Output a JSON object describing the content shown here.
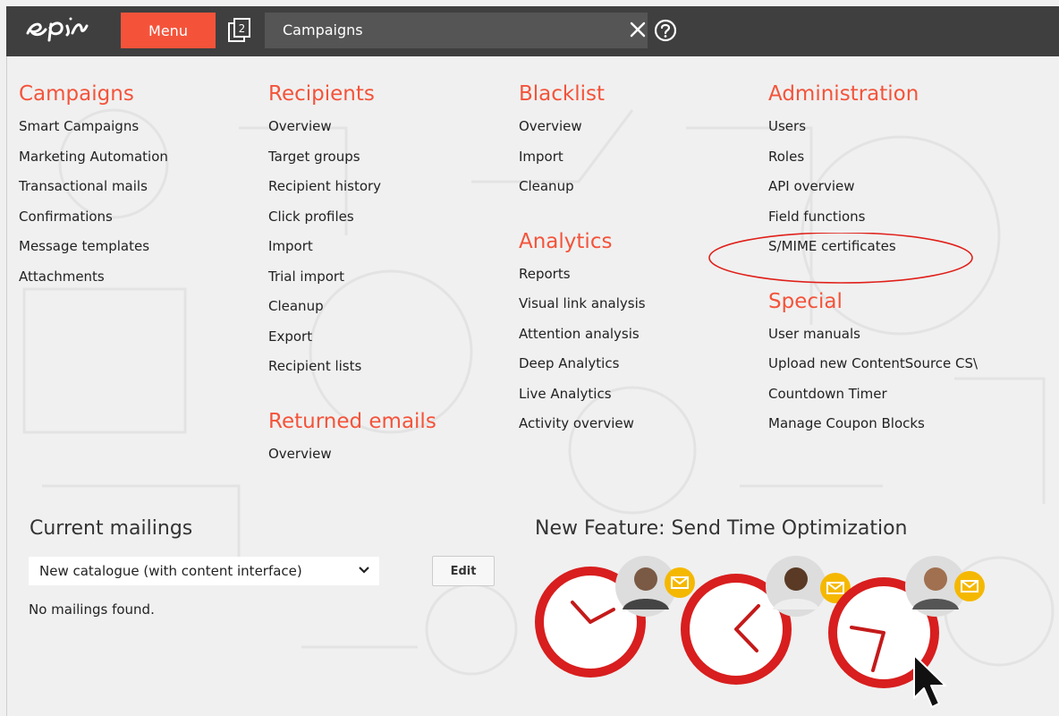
{
  "topbar": {
    "logo_text": "epi",
    "menu_label": "Menu",
    "open_windows_count": "2",
    "search_value": "Campaigns"
  },
  "columns": [
    {
      "sections": [
        {
          "title": "Campaigns",
          "items": [
            "Smart Campaigns",
            "Marketing Automation",
            "Transactional mails",
            "Confirmations",
            "Message templates",
            "Attachments"
          ]
        }
      ]
    },
    {
      "sections": [
        {
          "title": "Recipients",
          "items": [
            "Overview",
            "Target groups",
            "Recipient history",
            "Click profiles",
            "Import",
            "Trial import",
            "Cleanup",
            "Export",
            "Recipient lists"
          ]
        },
        {
          "title": "Returned emails",
          "items": [
            "Overview"
          ]
        }
      ]
    },
    {
      "sections": [
        {
          "title": "Blacklist",
          "items": [
            "Overview",
            "Import",
            "Cleanup"
          ]
        },
        {
          "title": "Analytics",
          "items": [
            "Reports",
            "Visual link analysis",
            "Attention analysis",
            "Deep Analytics",
            "Live Analytics",
            "Activity overview"
          ]
        }
      ]
    },
    {
      "sections": [
        {
          "title": "Administration",
          "items": [
            "Users",
            "Roles",
            "API overview",
            "Field functions",
            "S/MIME certificates"
          ]
        },
        {
          "title": "Special",
          "items": [
            "User manuals",
            "Upload new ContentSource CS\\",
            "Countdown Timer",
            "Manage Coupon Blocks"
          ]
        }
      ]
    }
  ],
  "current_mailings": {
    "title": "Current mailings",
    "selected": "New catalogue (with content interface)",
    "edit_label": "Edit",
    "empty_text": "No mailings found."
  },
  "feature": {
    "title": "New Feature: Send Time Optimization"
  },
  "colors": {
    "accent": "#f4533a",
    "topbar": "#3f3f3f",
    "background": "#f0f0f0",
    "highlight": "#e0201a"
  }
}
